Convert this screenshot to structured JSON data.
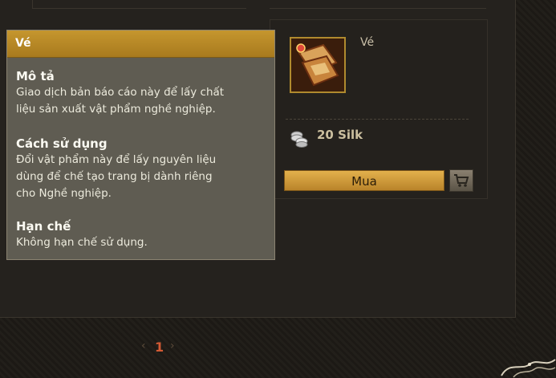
{
  "item": {
    "name": "Vé",
    "price": "20 Silk",
    "buy_label": "Mua"
  },
  "tooltip": {
    "title": "Vé",
    "sections": [
      {
        "heading": "Mô tả",
        "text_lines": [
          "Giao dịch bản báo cáo này để lấy chất",
          "liệu sản xuất vật phẩm nghề nghiệp."
        ]
      },
      {
        "heading": "Cách sử dụng",
        "text_lines": [
          "Đổi vật phẩm này để lấy nguyên liệu",
          "dùng để chế tạo trang bị dành riêng",
          "cho Nghề nghiệp."
        ]
      },
      {
        "heading": "Hạn chế",
        "text_lines": [
          "Không hạn chế sử dụng."
        ]
      }
    ]
  },
  "pagination": {
    "current_page": "1",
    "prev_icon": "chevron-left-icon",
    "next_icon": "chevron-right-icon"
  },
  "colors": {
    "accent_gold": "#c5962e",
    "page_number": "#d35a34"
  }
}
